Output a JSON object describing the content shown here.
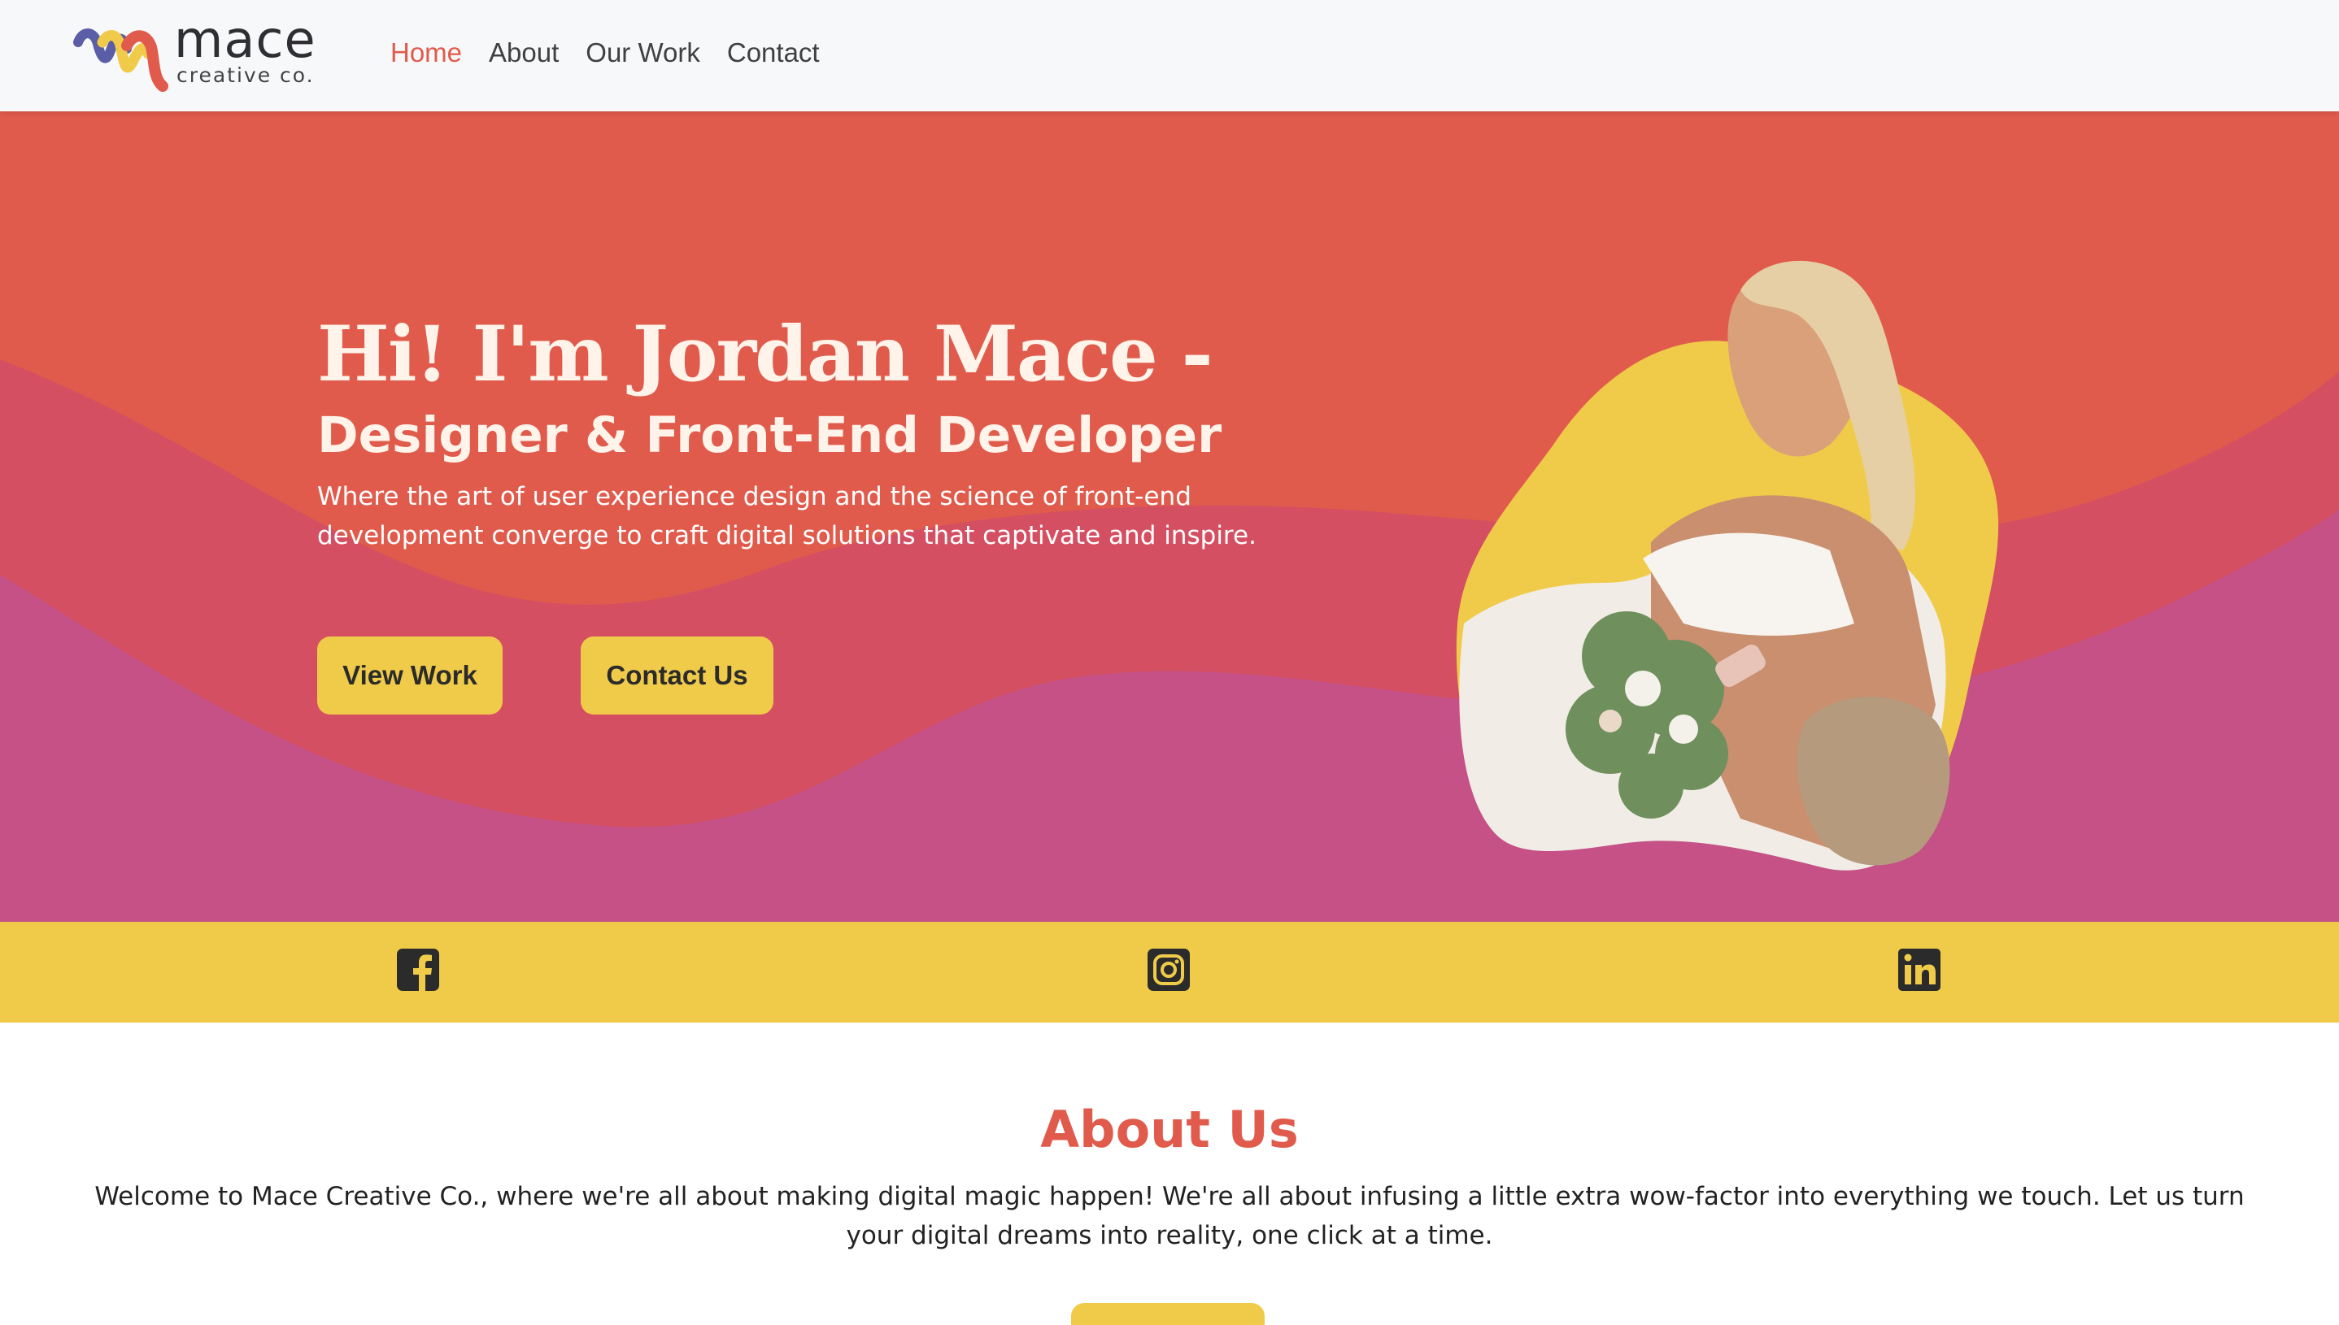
{
  "brand": {
    "name": "mace",
    "tagline": "creative co."
  },
  "nav": {
    "items": [
      {
        "label": "Home",
        "active": true
      },
      {
        "label": "About",
        "active": false
      },
      {
        "label": "Our Work",
        "active": false
      },
      {
        "label": "Contact",
        "active": false
      }
    ]
  },
  "hero": {
    "title": "Hi! I'm Jordan Mace -",
    "subtitle": "Designer & Front-End Developer",
    "description": "Where the art of user experience design and the science of front-end development converge to craft digital solutions that captivate and inspire.",
    "buttons": {
      "view_work": "View Work",
      "contact": "Contact Us"
    }
  },
  "social": {
    "icons": [
      "facebook-icon",
      "instagram-icon",
      "linkedin-icon"
    ]
  },
  "about": {
    "title": "About Us",
    "text": "Welcome to Mace Creative Co., where we're all about making digital magic happen! We're all about infusing a little extra wow-factor into everything we touch. Let us turn your digital dreams into reality, one click at a time."
  },
  "colors": {
    "coral": "#e05b4c",
    "pink": "#d44f6a",
    "magenta": "#c55187",
    "yellow": "#f0cb4a",
    "header_bg": "#f7f8fa"
  }
}
